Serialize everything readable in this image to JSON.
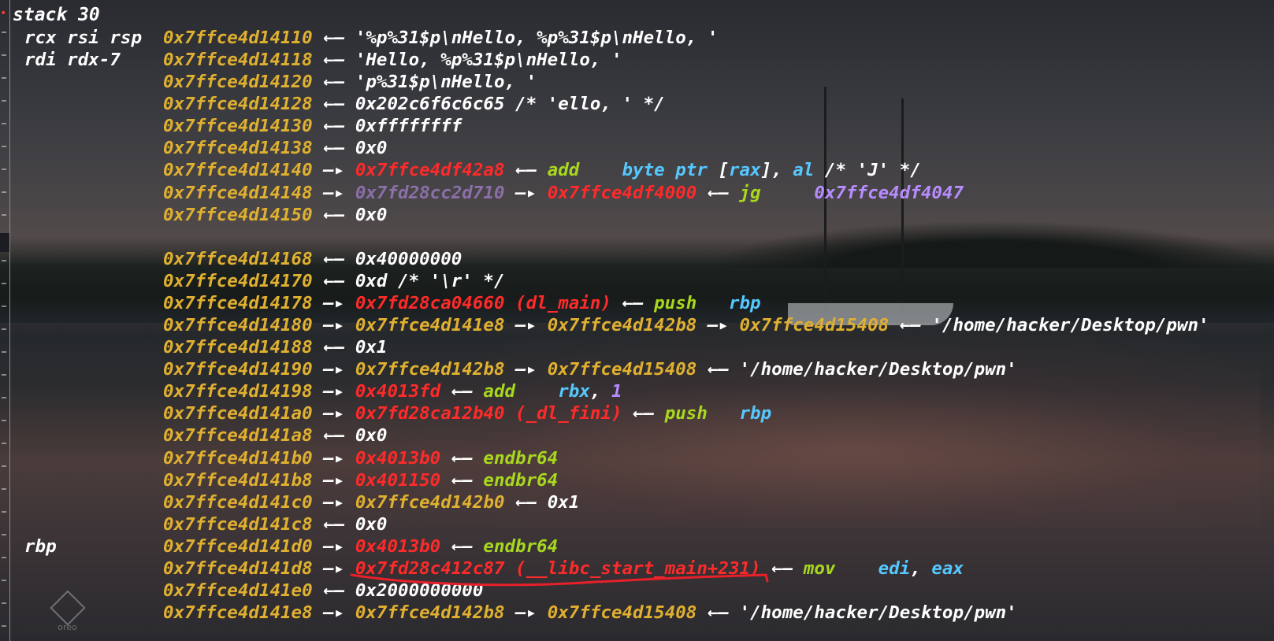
{
  "title": "stack 30",
  "colors": {
    "address": "#e0b030",
    "code_pointer": "#ff2a2a",
    "heap_pointer": "#8a6fa8",
    "instruction": "#a8d81e",
    "register_operand": "#55c8ff",
    "annotation_underline": "#e8202a"
  },
  "rows": [
    {
      "regs": "rcx rsi rsp",
      "parts": [
        {
          "t": "0x7ffce4d14110",
          "c": "addr"
        },
        {
          "t": " ←— ",
          "c": "white"
        },
        {
          "t": "'%p%31$p\\nHello, %p%31$p\\nHello, '",
          "c": "str"
        }
      ]
    },
    {
      "regs": "rdi rdx-7",
      "parts": [
        {
          "t": "0x7ffce4d14118",
          "c": "addr"
        },
        {
          "t": " ←— ",
          "c": "white"
        },
        {
          "t": "'Hello, %p%31$p\\nHello, '",
          "c": "str"
        }
      ]
    },
    {
      "regs": "",
      "parts": [
        {
          "t": "0x7ffce4d14120",
          "c": "addr"
        },
        {
          "t": " ←— ",
          "c": "white"
        },
        {
          "t": "'p%31$p\\nHello, '",
          "c": "str"
        }
      ]
    },
    {
      "regs": "",
      "parts": [
        {
          "t": "0x7ffce4d14128",
          "c": "addr"
        },
        {
          "t": " ←— ",
          "c": "white"
        },
        {
          "t": "0x202c6f6c6c65 /* 'ello, ' */",
          "c": "white"
        }
      ]
    },
    {
      "regs": "",
      "parts": [
        {
          "t": "0x7ffce4d14130",
          "c": "addr"
        },
        {
          "t": " ←— ",
          "c": "white"
        },
        {
          "t": "0xffffffff",
          "c": "white"
        }
      ]
    },
    {
      "regs": "",
      "parts": [
        {
          "t": "0x7ffce4d14138",
          "c": "addr"
        },
        {
          "t": " ←— ",
          "c": "white"
        },
        {
          "t": "0x0",
          "c": "white"
        }
      ]
    },
    {
      "regs": "",
      "parts": [
        {
          "t": "0x7ffce4d14140",
          "c": "addr"
        },
        {
          "t": " —▸ ",
          "c": "white"
        },
        {
          "t": "0x7ffce4df42a8",
          "c": "red"
        },
        {
          "t": " ←— ",
          "c": "white"
        },
        {
          "t": "add    ",
          "c": "green"
        },
        {
          "t": "byte ptr ",
          "c": "cyan"
        },
        {
          "t": "[",
          "c": "white"
        },
        {
          "t": "rax",
          "c": "cyan"
        },
        {
          "t": "], ",
          "c": "white"
        },
        {
          "t": "al",
          "c": "cyan"
        },
        {
          "t": " /* 'J' */",
          "c": "white"
        }
      ]
    },
    {
      "regs": "",
      "parts": [
        {
          "t": "0x7ffce4d14148",
          "c": "addr"
        },
        {
          "t": " —▸ ",
          "c": "white"
        },
        {
          "t": "0x7fd28cc2d710",
          "c": "purple"
        },
        {
          "t": " —▸ ",
          "c": "white"
        },
        {
          "t": "0x7ffce4df4000",
          "c": "red"
        },
        {
          "t": " ←— ",
          "c": "white"
        },
        {
          "t": "jg     ",
          "c": "green"
        },
        {
          "t": "0x7ffce4df4047",
          "c": "violet"
        }
      ]
    },
    {
      "regs": "",
      "parts": [
        {
          "t": "0x7ffce4d14150",
          "c": "addr"
        },
        {
          "t": " ←— ",
          "c": "white"
        },
        {
          "t": "0x0",
          "c": "white"
        }
      ]
    },
    {
      "regs": "",
      "gap": true,
      "parts": []
    },
    {
      "regs": "",
      "parts": [
        {
          "t": "0x7ffce4d14168",
          "c": "addr"
        },
        {
          "t": " ←— ",
          "c": "white"
        },
        {
          "t": "0x40000000",
          "c": "white"
        }
      ]
    },
    {
      "regs": "",
      "parts": [
        {
          "t": "0x7ffce4d14170",
          "c": "addr"
        },
        {
          "t": " ←— ",
          "c": "white"
        },
        {
          "t": "0xd /* '\\r' */",
          "c": "white"
        }
      ]
    },
    {
      "regs": "",
      "parts": [
        {
          "t": "0x7ffce4d14178",
          "c": "addr"
        },
        {
          "t": " —▸ ",
          "c": "white"
        },
        {
          "t": "0x7fd28ca04660 (dl_main)",
          "c": "red"
        },
        {
          "t": " ←— ",
          "c": "white"
        },
        {
          "t": "push   ",
          "c": "green"
        },
        {
          "t": "rbp",
          "c": "cyan"
        }
      ]
    },
    {
      "regs": "",
      "parts": [
        {
          "t": "0x7ffce4d14180",
          "c": "addr"
        },
        {
          "t": " —▸ ",
          "c": "white"
        },
        {
          "t": "0x7ffce4d141e8",
          "c": "addr"
        },
        {
          "t": " —▸ ",
          "c": "white"
        },
        {
          "t": "0x7ffce4d142b8",
          "c": "addr"
        },
        {
          "t": " —▸ ",
          "c": "white"
        },
        {
          "t": "0x7ffce4d15408",
          "c": "addr"
        },
        {
          "t": " ←— ",
          "c": "white"
        },
        {
          "t": "'/home/hacker/Desktop/pwn'",
          "c": "str"
        }
      ]
    },
    {
      "regs": "",
      "parts": [
        {
          "t": "0x7ffce4d14188",
          "c": "addr"
        },
        {
          "t": " ←— ",
          "c": "white"
        },
        {
          "t": "0x1",
          "c": "white"
        }
      ]
    },
    {
      "regs": "",
      "parts": [
        {
          "t": "0x7ffce4d14190",
          "c": "addr"
        },
        {
          "t": " —▸ ",
          "c": "white"
        },
        {
          "t": "0x7ffce4d142b8",
          "c": "addr"
        },
        {
          "t": " —▸ ",
          "c": "white"
        },
        {
          "t": "0x7ffce4d15408",
          "c": "addr"
        },
        {
          "t": " ←— ",
          "c": "white"
        },
        {
          "t": "'/home/hacker/Desktop/pwn'",
          "c": "str"
        }
      ]
    },
    {
      "regs": "",
      "parts": [
        {
          "t": "0x7ffce4d14198",
          "c": "addr"
        },
        {
          "t": " —▸ ",
          "c": "white"
        },
        {
          "t": "0x4013fd",
          "c": "red"
        },
        {
          "t": " ←— ",
          "c": "white"
        },
        {
          "t": "add    ",
          "c": "green"
        },
        {
          "t": "rbx",
          "c": "cyan"
        },
        {
          "t": ", ",
          "c": "white"
        },
        {
          "t": "1",
          "c": "violet"
        }
      ]
    },
    {
      "regs": "",
      "parts": [
        {
          "t": "0x7ffce4d141a0",
          "c": "addr"
        },
        {
          "t": " —▸ ",
          "c": "white"
        },
        {
          "t": "0x7fd28ca12b40 (_dl_fini)",
          "c": "red"
        },
        {
          "t": " ←— ",
          "c": "white"
        },
        {
          "t": "push   ",
          "c": "green"
        },
        {
          "t": "rbp",
          "c": "cyan"
        }
      ]
    },
    {
      "regs": "",
      "parts": [
        {
          "t": "0x7ffce4d141a8",
          "c": "addr"
        },
        {
          "t": " ←— ",
          "c": "white"
        },
        {
          "t": "0x0",
          "c": "white"
        }
      ]
    },
    {
      "regs": "",
      "parts": [
        {
          "t": "0x7ffce4d141b0",
          "c": "addr"
        },
        {
          "t": " —▸ ",
          "c": "white"
        },
        {
          "t": "0x4013b0",
          "c": "red"
        },
        {
          "t": " ←— ",
          "c": "white"
        },
        {
          "t": "endbr64",
          "c": "green"
        }
      ]
    },
    {
      "regs": "",
      "parts": [
        {
          "t": "0x7ffce4d141b8",
          "c": "addr"
        },
        {
          "t": " —▸ ",
          "c": "white"
        },
        {
          "t": "0x401150",
          "c": "red"
        },
        {
          "t": " ←— ",
          "c": "white"
        },
        {
          "t": "endbr64",
          "c": "green"
        }
      ]
    },
    {
      "regs": "",
      "parts": [
        {
          "t": "0x7ffce4d141c0",
          "c": "addr"
        },
        {
          "t": " —▸ ",
          "c": "white"
        },
        {
          "t": "0x7ffce4d142b0",
          "c": "addr"
        },
        {
          "t": " ←— ",
          "c": "white"
        },
        {
          "t": "0x1",
          "c": "white"
        }
      ]
    },
    {
      "regs": "",
      "parts": [
        {
          "t": "0x7ffce4d141c8",
          "c": "addr"
        },
        {
          "t": " ←— ",
          "c": "white"
        },
        {
          "t": "0x0",
          "c": "white"
        }
      ]
    },
    {
      "regs": "rbp",
      "parts": [
        {
          "t": "0x7ffce4d141d0",
          "c": "addr"
        },
        {
          "t": " —▸ ",
          "c": "white"
        },
        {
          "t": "0x4013b0",
          "c": "red"
        },
        {
          "t": " ←— ",
          "c": "white"
        },
        {
          "t": "endbr64",
          "c": "green"
        }
      ]
    },
    {
      "regs": "",
      "parts": [
        {
          "t": "0x7ffce4d141d8",
          "c": "addr"
        },
        {
          "t": " —▸ ",
          "c": "white"
        },
        {
          "t": "0x7fd28c412c87 (__libc_start_main+231)",
          "c": "red"
        },
        {
          "t": " ←— ",
          "c": "white"
        },
        {
          "t": "mov    ",
          "c": "green"
        },
        {
          "t": "edi",
          "c": "cyan"
        },
        {
          "t": ", ",
          "c": "white"
        },
        {
          "t": "eax",
          "c": "cyan"
        }
      ]
    },
    {
      "regs": "",
      "parts": [
        {
          "t": "0x7ffce4d141e0",
          "c": "addr"
        },
        {
          "t": " ←— ",
          "c": "white"
        },
        {
          "t": "0x2000000000",
          "c": "white"
        }
      ]
    },
    {
      "regs": "",
      "parts": [
        {
          "t": "0x7ffce4d141e8",
          "c": "addr"
        },
        {
          "t": " —▸ ",
          "c": "white"
        },
        {
          "t": "0x7ffce4d142b8",
          "c": "addr"
        },
        {
          "t": " —▸ ",
          "c": "white"
        },
        {
          "t": "0x7ffce4d15408",
          "c": "addr"
        },
        {
          "t": " ←— ",
          "c": "white"
        },
        {
          "t": "'/home/hacker/Desktop/pwn'",
          "c": "str"
        }
      ]
    }
  ],
  "watermark": {
    "icon": "diamond-logo-icon",
    "text": "oreo"
  }
}
